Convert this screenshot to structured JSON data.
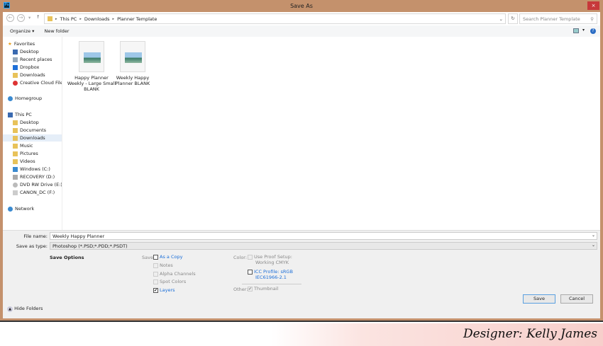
{
  "window": {
    "title": "Save As",
    "close": "×",
    "app_icon": "Ps"
  },
  "address": {
    "breadcrumb": [
      "This PC",
      "Downloads",
      "Planner Template"
    ],
    "search_placeholder": "Search Planner Template"
  },
  "toolbar": {
    "organize": "Organize ▾",
    "new_folder": "New folder"
  },
  "sidebar": {
    "favorites": "Favorites",
    "fav_items": [
      "Desktop",
      "Recent places",
      "Dropbox",
      "Downloads",
      "Creative Cloud Files"
    ],
    "homegroup": "Homegroup",
    "this_pc": "This PC",
    "pc_items": [
      "Desktop",
      "Documents",
      "Downloads",
      "Music",
      "Pictures",
      "Videos",
      "Windows (C:)",
      "RECOVERY (D:)",
      "DVD RW Drive (E:) SE",
      "CANON_DC (F:)"
    ],
    "network": "Network"
  },
  "files": [
    {
      "name": "Happy Planner Weekly - Large Small BLANK"
    },
    {
      "name": "Weekly Happy Planner BLANK"
    }
  ],
  "form": {
    "file_name_label": "File name:",
    "file_name": "Weekly Happy Planner",
    "type_label": "Save as type:",
    "type": "Photoshop (*.PSD;*.PDD;*.PSDT)"
  },
  "options": {
    "title": "Save Options",
    "save_label": "Save:",
    "as_copy": "As a Copy",
    "notes": "Notes",
    "alpha": "Alpha Channels",
    "spot": "Spot Colors",
    "layers": "Layers",
    "color_label": "Color:",
    "proof": "Use Proof Setup:",
    "proof2": "Working CMYK",
    "icc": "ICC Profile:  sRGB",
    "icc2": "IEC61966-2.1",
    "other_label": "Other:",
    "thumbnail": "Thumbnail"
  },
  "buttons": {
    "hide_folders": "Hide Folders",
    "save": "Save",
    "cancel": "Cancel"
  },
  "footer": {
    "signature": "Designer: Kelly James"
  },
  "colors": {
    "frame": "#c4916c",
    "close": "#c7383a",
    "link": "#1a6ed8"
  }
}
